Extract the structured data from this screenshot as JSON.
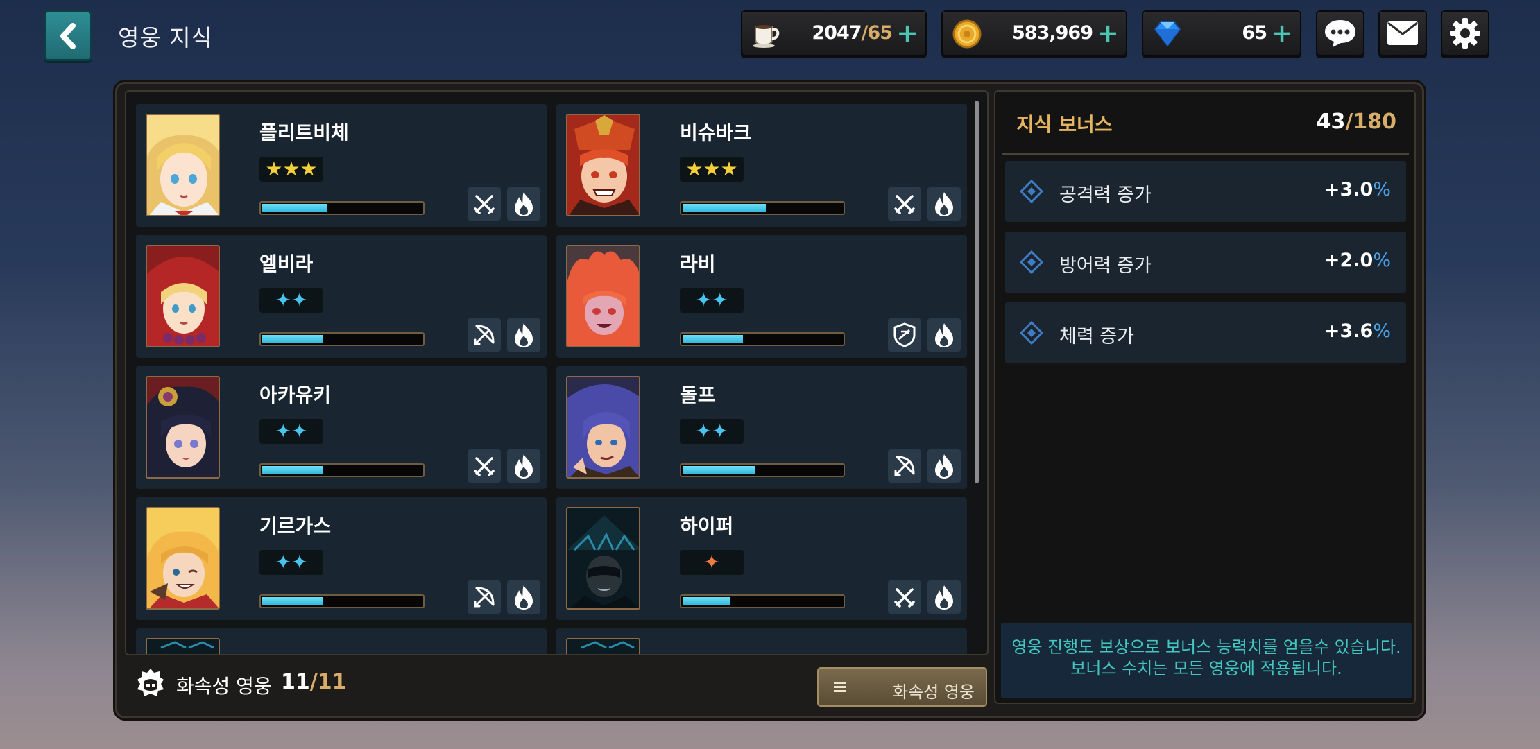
{
  "header": {
    "title": "영웅 지식",
    "back_icon": "chevron-left-icon"
  },
  "currencies": [
    {
      "name": "stamina",
      "icon": "coffee-cup-icon",
      "value": "2047",
      "max": "65",
      "separator": "/",
      "plus": "+"
    },
    {
      "name": "gold",
      "icon": "gold-coin-icon",
      "value": "583,969",
      "plus": "+"
    },
    {
      "name": "gem",
      "icon": "diamond-gem-icon",
      "value": "65",
      "plus": "+"
    }
  ],
  "toolbar_icons": [
    "chat-bubble-icon",
    "mail-icon",
    "gear-icon"
  ],
  "heroes": [
    {
      "name": "플리트비체",
      "stars": "★★★",
      "star_color": "gold",
      "xp_fraction": 0.41,
      "class_icon": "crossed-swords-icon",
      "element_icon": "fire-icon"
    },
    {
      "name": "비슈바크",
      "stars": "★★★",
      "star_color": "gold",
      "xp_fraction": 0.52,
      "class_icon": "crossed-swords-icon",
      "element_icon": "fire-icon"
    },
    {
      "name": "엘비라",
      "stars": "✦✦",
      "star_color": "blue",
      "xp_fraction": 0.38,
      "class_icon": "bow-icon",
      "element_icon": "fire-icon"
    },
    {
      "name": "라비",
      "stars": "✦✦",
      "star_color": "blue",
      "xp_fraction": 0.38,
      "class_icon": "shield-icon",
      "element_icon": "fire-icon"
    },
    {
      "name": "아카유키",
      "stars": "✦✦",
      "star_color": "blue",
      "xp_fraction": 0.38,
      "class_icon": "crossed-swords-icon",
      "element_icon": "fire-icon"
    },
    {
      "name": "돌프",
      "stars": "✦✦",
      "star_color": "blue",
      "xp_fraction": 0.45,
      "class_icon": "bow-icon",
      "element_icon": "fire-icon"
    },
    {
      "name": "기르가스",
      "stars": "✦✦",
      "star_color": "blue",
      "xp_fraction": 0.38,
      "class_icon": "bow-icon",
      "element_icon": "fire-icon"
    },
    {
      "name": "하이퍼",
      "stars": "✦",
      "star_color": "orange",
      "xp_fraction": 0.3,
      "class_icon": "crossed-swords-icon",
      "element_icon": "fire-icon"
    }
  ],
  "bottom": {
    "label": "화속성 영웅",
    "count": "11",
    "separator": "/",
    "max": "11",
    "filter_label": "화속성 영웅",
    "filter_icon": "menu-lines-icon",
    "helmet_icon": "helmet-icon"
  },
  "bonus": {
    "title": "지식 보너스",
    "count": "43",
    "separator": "/",
    "max": "180",
    "stats": [
      {
        "label": "공격력 증가",
        "value": "+3.0",
        "unit": "%"
      },
      {
        "label": "방어력 증가",
        "value": "+2.0",
        "unit": "%"
      },
      {
        "label": "체력 증가",
        "value": "+3.6",
        "unit": "%"
      }
    ],
    "note_line1": "영웅 진행도 보상으로 보너스 능력치를 얻을수 있습니다.",
    "note_line2": "보너스 수치는 모든 영웅에 적용됩니다."
  },
  "colors": {
    "accent_teal": "#2f8d94",
    "gold_text": "#d8ad6a",
    "bonus_title": "#e6b45e",
    "xp_fill": "#2eb5d9",
    "note_text": "#43c6c0",
    "percent_blue": "#4aa3ec"
  }
}
